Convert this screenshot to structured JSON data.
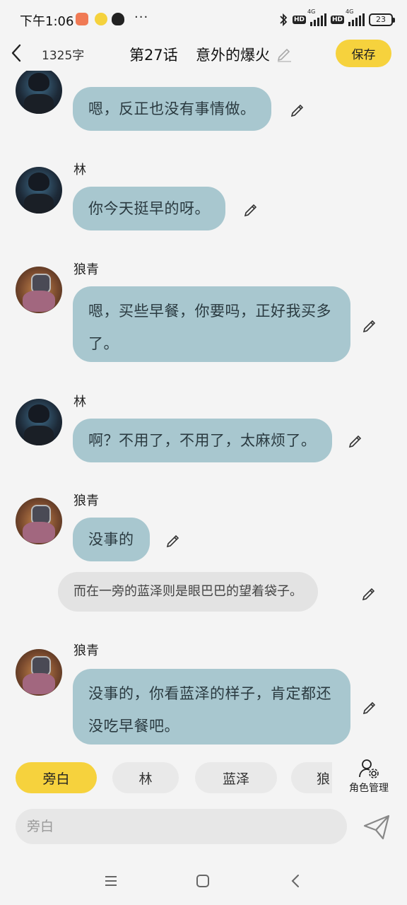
{
  "status_bar": {
    "time": "下午1:06",
    "more": "···",
    "hd1": "HD",
    "hd2": "HD",
    "net1": "4G",
    "net2": "4G",
    "battery": "23"
  },
  "header": {
    "word_count": "1325字",
    "episode": "第27话",
    "title": "意外的爆火",
    "save_label": "保存"
  },
  "messages": [
    {
      "type": "dialogue",
      "speaker": "",
      "avatar": "lin",
      "text": "嗯，反正也没有事情做。"
    },
    {
      "type": "dialogue",
      "speaker": "林",
      "avatar": "lin",
      "text": "你今天挺早的呀。"
    },
    {
      "type": "dialogue",
      "speaker": "狼青",
      "avatar": "langqing",
      "text": "嗯，买些早餐，你要吗，正好我买多了。"
    },
    {
      "type": "dialogue",
      "speaker": "林",
      "avatar": "lin",
      "text": "啊？不用了，不用了，太麻烦了。"
    },
    {
      "type": "dialogue",
      "speaker": "狼青",
      "avatar": "langqing",
      "text": "没事的"
    },
    {
      "type": "narration",
      "text": "而在一旁的蓝泽则是眼巴巴的望着袋子。"
    },
    {
      "type": "dialogue",
      "speaker": "狼青",
      "avatar": "langqing",
      "text": "没事的，你看蓝泽的样子，肯定都还没吃早餐吧。"
    }
  ],
  "roles": {
    "chips": [
      "旁白",
      "林",
      "蓝泽",
      "狼"
    ],
    "active": "旁白",
    "manage_label": "角色管理"
  },
  "input": {
    "placeholder": "旁白",
    "value": ""
  },
  "colors": {
    "accent": "#f6d23d",
    "bubble": "#a8c7cf",
    "narration": "#e3e3e3",
    "background": "#f4f4f4"
  }
}
